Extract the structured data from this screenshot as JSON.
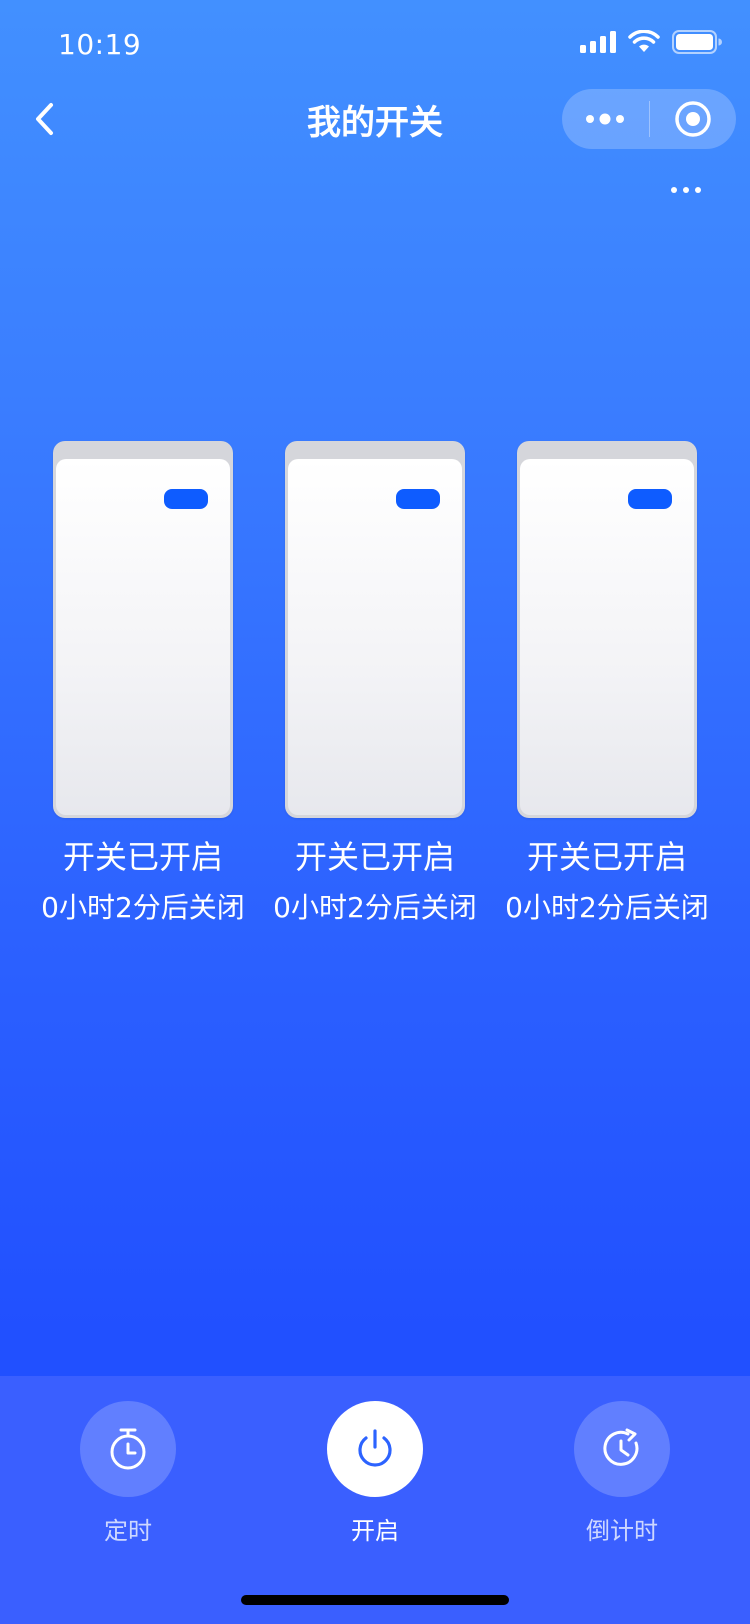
{
  "status_bar": {
    "time": "10:19"
  },
  "nav": {
    "title": "我的开关"
  },
  "switches": [
    {
      "status": "开关已开启",
      "timer": "0小时2分后关闭"
    },
    {
      "status": "开关已开启",
      "timer": "0小时2分后关闭"
    },
    {
      "status": "开关已开启",
      "timer": "0小时2分后关闭"
    }
  ],
  "actions": [
    {
      "label": "定时",
      "icon": "timer-icon"
    },
    {
      "label": "开启",
      "icon": "power-icon"
    },
    {
      "label": "倒计时",
      "icon": "countdown-icon"
    }
  ],
  "colors": {
    "gradient_top": "#4290ff",
    "gradient_bottom": "#2150ff",
    "bottom_bar": "#3a5fff",
    "switch_led": "#0e5cff"
  }
}
